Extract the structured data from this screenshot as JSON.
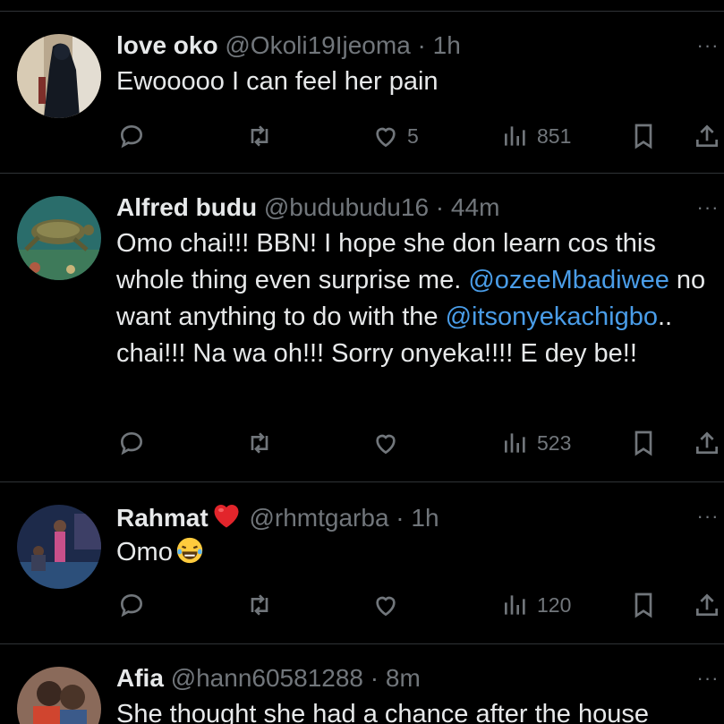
{
  "tweets": [
    {
      "name": "love oko",
      "handle": "@Okoli19Ijeoma",
      "sep": " · ",
      "time": "1h",
      "body": "Ewooooo I can feel her pain",
      "likes": "5",
      "views": "851",
      "avatar_icon": "avatar-dark-figure"
    },
    {
      "name": "Alfred budu",
      "handle": "@budubudu16",
      "sep": " · ",
      "time": "44m",
      "body_parts": {
        "p1": "Omo chai!!! BBN! I hope she don learn cos this whole thing even surprise me. ",
        "m1": "@ozeeMbadiwee",
        "p2": " no want anything to do with the ",
        "m2": "@itsonyekachigbo",
        "p3": ".. chai!!! Na wa oh!!! Sorry onyeka!!!! E dey be!!"
      },
      "likes": "",
      "views": "523",
      "avatar_icon": "avatar-sea-turtle"
    },
    {
      "name": "Rahmat",
      "name_emoji": "red-heart",
      "handle": "@rhmtgarba",
      "sep": " · ",
      "time": "1h",
      "body": "Omo",
      "body_emoji": "tears-of-joy",
      "likes": "",
      "views": "120",
      "avatar_icon": "avatar-stage-dancers"
    },
    {
      "name": "Afia",
      "handle": "@hann60581288",
      "sep": " · ",
      "time": "8m",
      "body": "She thought she had a chance after the house",
      "avatar_icon": "avatar-hugging-people"
    }
  ],
  "more_label": "···",
  "colors": {
    "background": "#000000",
    "text": "#e7e9ea",
    "muted": "#71767b",
    "link": "#1d9bf0",
    "divider": "#2f3336"
  },
  "icons": [
    "reply-icon",
    "retweet-icon",
    "like-icon",
    "views-icon",
    "bookmark-icon",
    "share-icon"
  ]
}
